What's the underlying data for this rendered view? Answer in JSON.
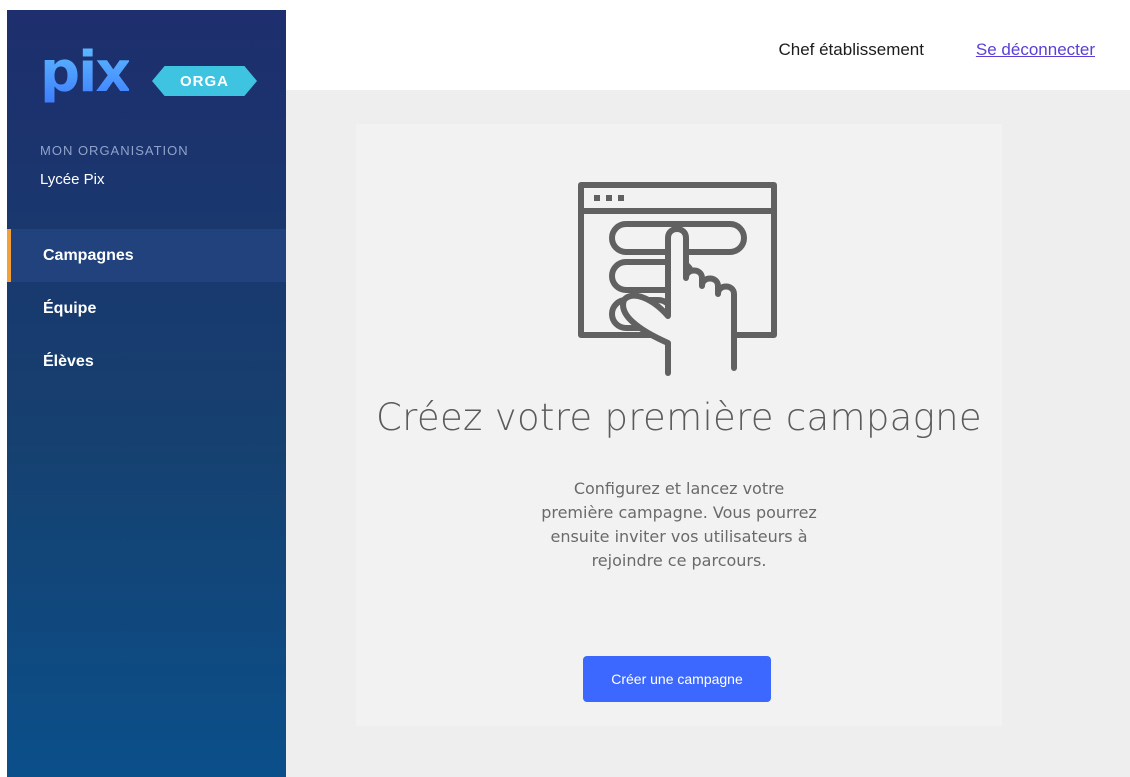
{
  "sidebar": {
    "logo_text": "pix",
    "logo_badge": "ORGA",
    "org_label": "MON ORGANISATION",
    "org_name": "Lycée Pix",
    "items": [
      {
        "label": "Campagnes",
        "active": true
      },
      {
        "label": "Équipe",
        "active": false
      },
      {
        "label": "Élèves",
        "active": false
      }
    ]
  },
  "header": {
    "user_name": "Chef établissement",
    "logout_label": "Se déconnecter"
  },
  "main": {
    "illustration_icon": "hand-pointing-list-icon",
    "headline": "Créez votre première campagne",
    "description": "Configurez et lancez votre première campagne. Vous pourrez ensuite inviter vos utilisateurs à rejoindre ce parcours.",
    "cta_label": "Créer une campagne"
  },
  "colors": {
    "sidebar_top": "#1e2e6e",
    "sidebar_bottom": "#0b4f8a",
    "active_indicator": "#f2a13a",
    "primary_button": "#3d68ff",
    "logout_link": "#5a3fd6"
  }
}
